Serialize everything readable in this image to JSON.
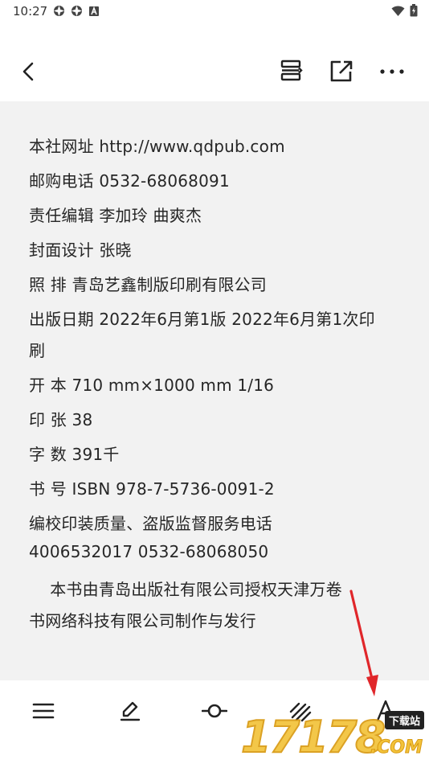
{
  "status_bar": {
    "time": "10:27",
    "notification_icons": [
      "sync-icon",
      "sync-icon",
      "a-badge-icon"
    ],
    "right_icons": [
      "wifi-icon",
      "battery-icon"
    ]
  },
  "top_bar": {
    "back_icon": "chevron-left-icon",
    "actions": [
      "toc-icon",
      "share-icon",
      "more-icon"
    ]
  },
  "content": {
    "lines": [
      "本社网址 http://www.qdpub.com",
      "邮购电话 0532-68068091",
      "责任编辑 李加玲 曲爽杰",
      "封面设计 张晓",
      "照 排 青岛艺鑫制版印刷有限公司",
      "出版日期  2022年6月第1版  2022年6月第1次印",
      "刷",
      "开 本 710 mm×1000 mm 1/16",
      "印 张 38",
      "字 数 391千",
      "书 号 ISBN 978-7-5736-0091-2",
      "编校印装质量、盗版监督服务电话",
      "4006532017 0532-68068050",
      "    本书由青岛出版社有限公司授权天津万卷",
      "书网络科技有限公司制作与发行"
    ]
  },
  "bottom_bar": {
    "items": [
      "menu-icon",
      "pen-icon",
      "progress-icon",
      "brightness-icon",
      "font-icon"
    ]
  },
  "watermark": {
    "number": "17178",
    "tag": "下载站",
    "suffix": ".COM"
  },
  "colors": {
    "background": "#f2f2f2",
    "bar_background": "#ffffff",
    "text": "#262626",
    "arrow": "#e0262a"
  }
}
